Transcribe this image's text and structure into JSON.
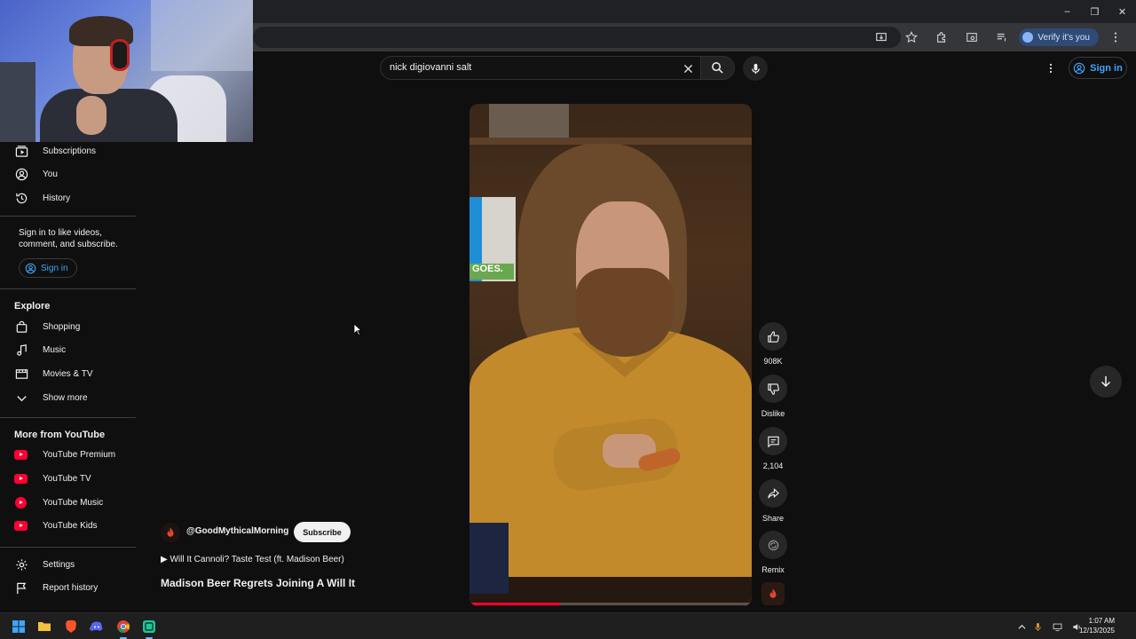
{
  "browser": {
    "window_controls": [
      "–",
      "❐",
      "✕"
    ],
    "verify_label": "Verify it's you"
  },
  "youtube": {
    "search": {
      "value": "nick digiovanni salt"
    },
    "sign_in_label": "Sign in"
  },
  "sidebar": {
    "top_items": [
      {
        "label": "Subscriptions",
        "icon": "subscriptions-icon"
      },
      {
        "label": "You",
        "icon": "user-circle-icon"
      },
      {
        "label": "History",
        "icon": "history-icon"
      }
    ],
    "sign_in_prompt": "Sign in to like videos, comment, and subscribe.",
    "sign_in_button": "Sign in",
    "explore_title": "Explore",
    "explore_items": [
      {
        "label": "Shopping",
        "icon": "shopping-bag-icon"
      },
      {
        "label": "Music",
        "icon": "music-note-icon"
      },
      {
        "label": "Movies & TV",
        "icon": "film-icon"
      },
      {
        "label": "Show more",
        "icon": "chevron-down-icon"
      }
    ],
    "more_title": "More from YouTube",
    "more_items": [
      {
        "label": "YouTube Premium",
        "icon": "youtube-premium-icon"
      },
      {
        "label": "YouTube TV",
        "icon": "youtube-tv-icon"
      },
      {
        "label": "YouTube Music",
        "icon": "youtube-music-icon"
      },
      {
        "label": "YouTube Kids",
        "icon": "youtube-kids-icon"
      }
    ],
    "bottom_items": [
      {
        "label": "Settings",
        "icon": "gear-icon"
      },
      {
        "label": "Report history",
        "icon": "flag-icon"
      }
    ]
  },
  "short": {
    "channel": "@GoodMythicalMorning",
    "subscribe_label": "Subscribe",
    "music_line": "▶ Will It Cannoli? Taste Test (ft. Madison Beer)",
    "title": "Madison Beer Regrets Joining A Will It",
    "poster_text": "GOES.",
    "progress": 0.32,
    "actions": [
      {
        "label": "908K",
        "icon": "thumbs-up-icon"
      },
      {
        "label": "Dislike",
        "icon": "thumbs-down-icon"
      },
      {
        "label": "2,104",
        "icon": "comment-icon"
      },
      {
        "label": "Share",
        "icon": "share-icon"
      },
      {
        "label": "Remix",
        "icon": "remix-icon"
      }
    ]
  },
  "taskbar": {
    "apps": [
      "windows-start-icon",
      "file-explorer-icon",
      "brave-browser-icon",
      "discord-icon",
      "chrome-icon",
      "app-icon"
    ],
    "time": "1:07 AM",
    "date": "12/13/2025"
  },
  "colors": {
    "accent_blue": "#3ea6ff",
    "youtube_red": "#ff0033",
    "background": "#0f0f0f"
  }
}
